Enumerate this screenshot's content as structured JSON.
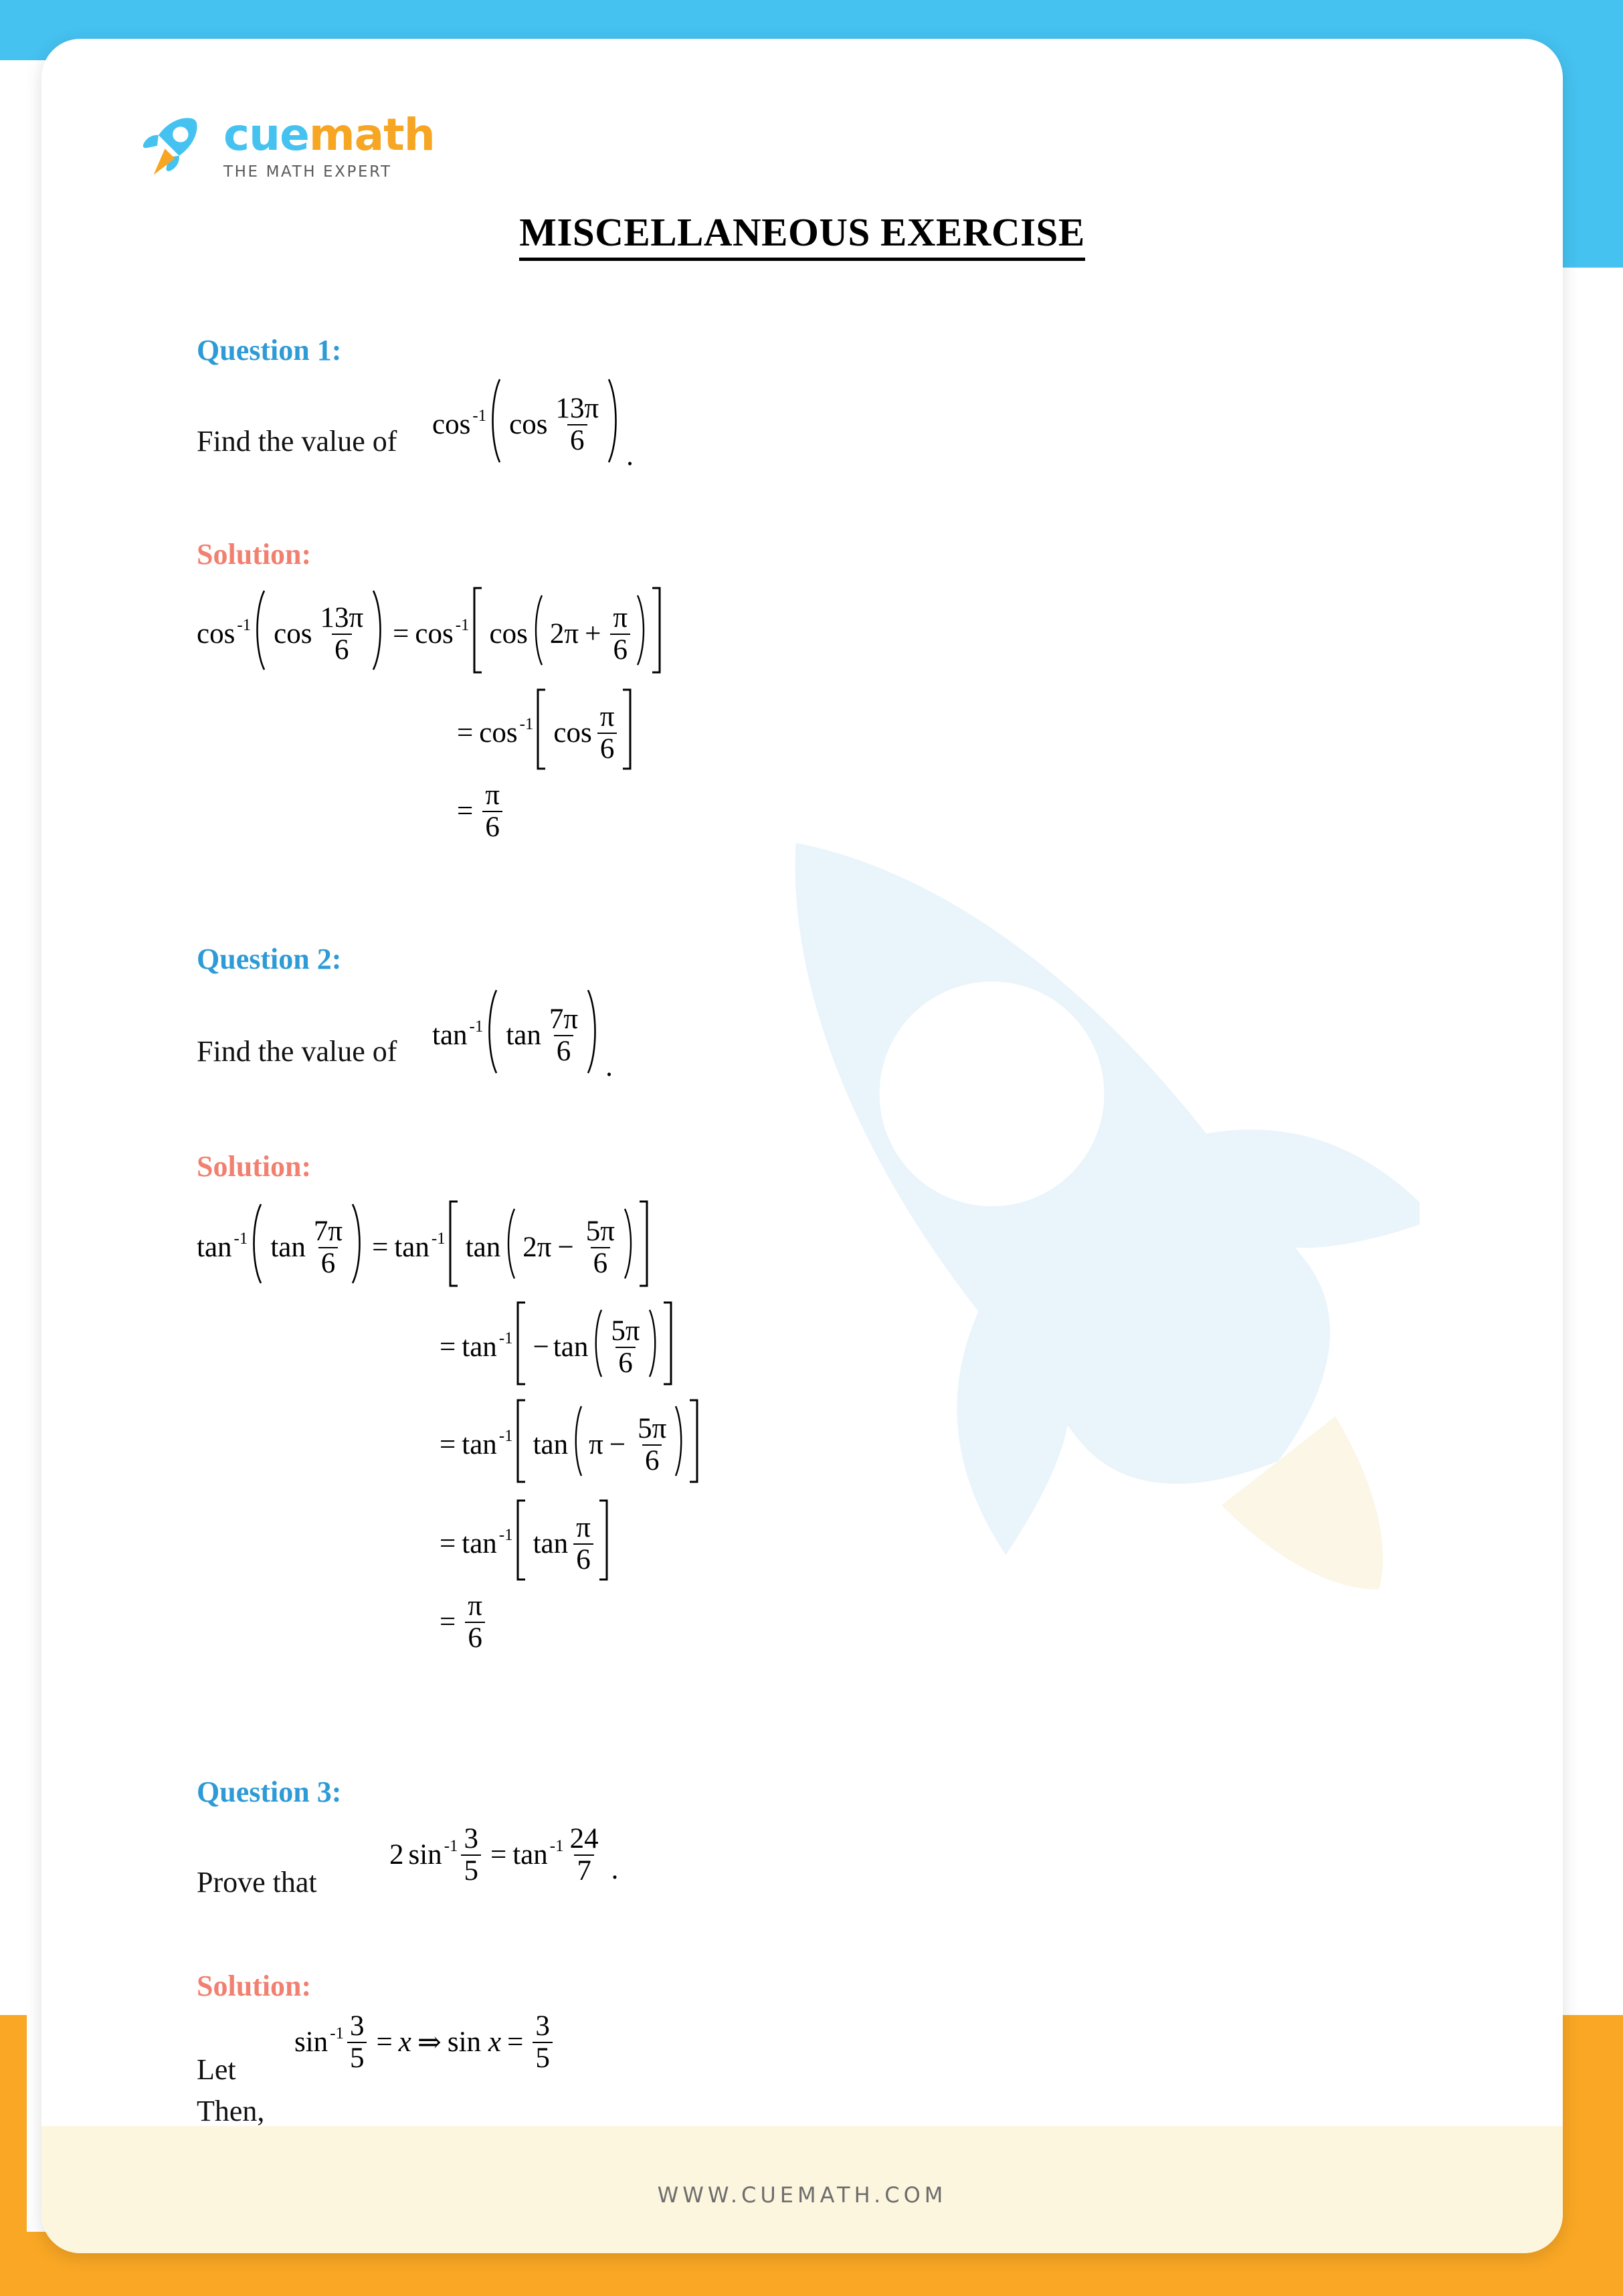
{
  "brand": {
    "logo_cue": "cue",
    "logo_math": "math",
    "tagline": "THE MATH EXPERT",
    "rocket_icon": "rocket-icon",
    "accent_blue": "#45C2F0",
    "accent_orange": "#F9A724",
    "heading_blue": "#2E9BD6",
    "solution_salmon": "#F28070",
    "footer_band": "#FDF6DE"
  },
  "document": {
    "title": "MISCELLANEOUS EXERCISE"
  },
  "questions": [
    {
      "heading": "Question 1:",
      "prompt_text": "Find the value of",
      "prompt_trailing": ".",
      "prompt_math": {
        "fn": "cos",
        "inv": "-1",
        "inner_fn": "cos",
        "num": "13π",
        "den": "6"
      },
      "solution_heading": "Solution:",
      "steps": [
        {
          "lhs_fn": "cos",
          "lhs_inv": "-1",
          "lhs_inner_fn": "cos",
          "lhs_num": "13π",
          "lhs_den": "6",
          "eq": "=",
          "rhs_fn": "cos",
          "rhs_inv": "-1",
          "rhs_inner_fn": "cos",
          "rhs_lead": "2π",
          "rhs_op": "+",
          "rhs_num": "π",
          "rhs_den": "6"
        },
        {
          "eq": "=",
          "fn": "cos",
          "inv": "-1",
          "inner_fn": "cos",
          "num": "π",
          "den": "6"
        },
        {
          "eq": "=",
          "num": "π",
          "den": "6"
        }
      ]
    },
    {
      "heading": "Question 2:",
      "prompt_text": "Find the value of",
      "prompt_trailing": ".",
      "prompt_math": {
        "fn": "tan",
        "inv": "-1",
        "inner_fn": "tan",
        "num": "7π",
        "den": "6"
      },
      "solution_heading": "Solution:",
      "steps": [
        {
          "lhs_fn": "tan",
          "lhs_inv": "-1",
          "lhs_inner_fn": "tan",
          "lhs_num": "7π",
          "lhs_den": "6",
          "eq": "=",
          "rhs_fn": "tan",
          "rhs_inv": "-1",
          "rhs_inner_fn": "tan",
          "rhs_lead": "2π",
          "rhs_op": "−",
          "rhs_num": "5π",
          "rhs_den": "6"
        },
        {
          "eq": "=",
          "fn": "tan",
          "inv": "-1",
          "sign": "−",
          "inner_fn": "tan",
          "num": "5π",
          "den": "6"
        },
        {
          "eq": "=",
          "fn": "tan",
          "inv": "-1",
          "inner_fn": "tan",
          "lead": "π",
          "op": "−",
          "num": "5π",
          "den": "6"
        },
        {
          "eq": "=",
          "fn": "tan",
          "inv": "-1",
          "inner_fn": "tan",
          "num": "π",
          "den": "6"
        },
        {
          "eq": "=",
          "num": "π",
          "den": "6"
        }
      ]
    },
    {
      "heading": "Question 3:",
      "prompt_text": "Prove that",
      "prompt_trailing": ".",
      "prompt_math": {
        "coef": "2",
        "fn": "sin",
        "inv": "-1",
        "num": "3",
        "den": "5",
        "eq": "=",
        "rhs_fn": "tan",
        "rhs_inv": "-1",
        "rhs_num": "24",
        "rhs_den": "7"
      },
      "solution_heading": "Solution:",
      "let_label": "Let",
      "let_math": {
        "fn": "sin",
        "inv": "-1",
        "num": "3",
        "den": "5",
        "eq": "=",
        "var": "x",
        "implies": "⇒",
        "fn2": "sin",
        "var2": "x",
        "eq2": "=",
        "num2": "3",
        "den2": "5"
      },
      "then_label": "Then,"
    }
  ],
  "footer": {
    "url": "WWW.CUEMATH.COM"
  }
}
